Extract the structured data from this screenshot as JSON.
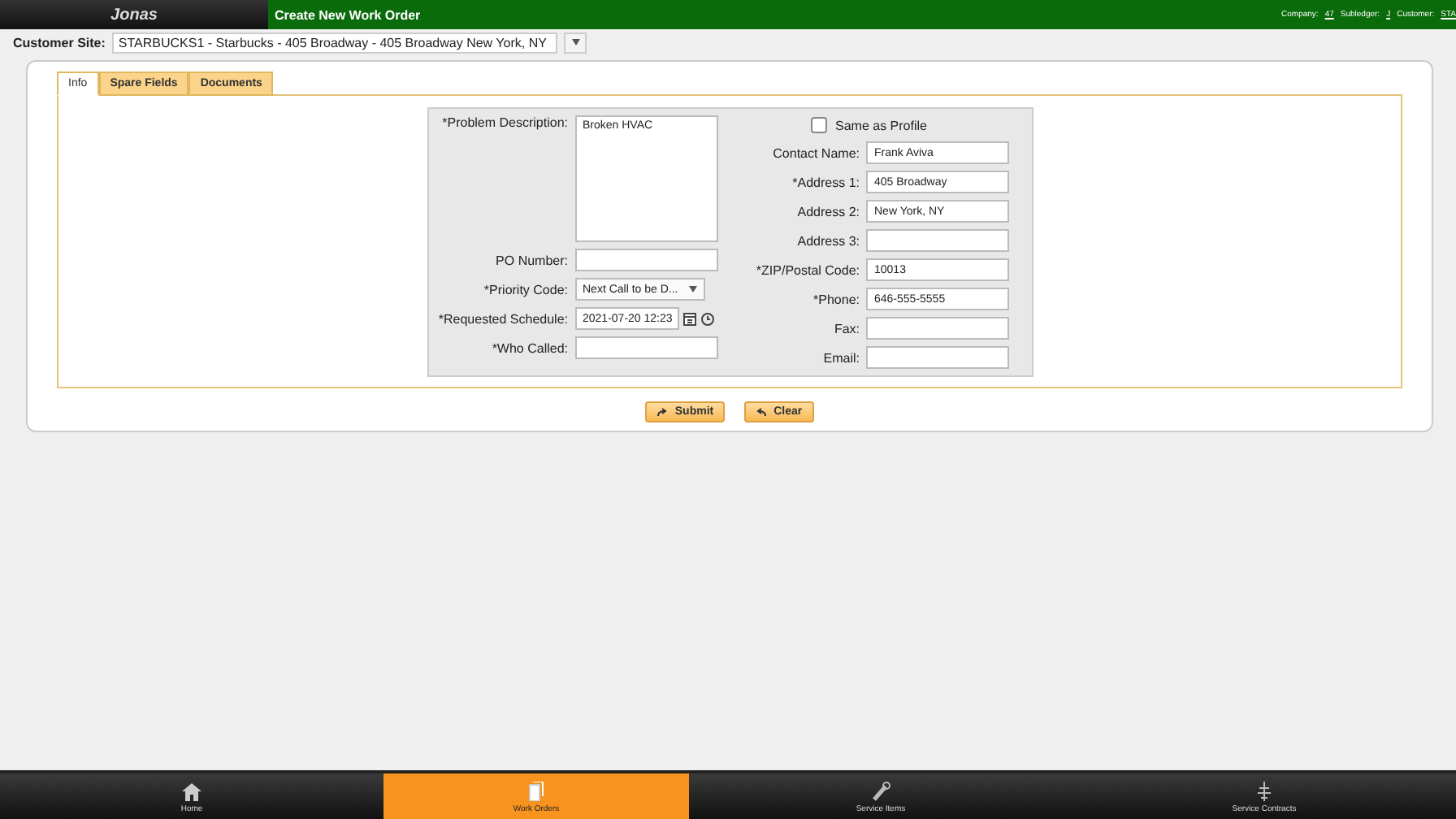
{
  "header": {
    "logo": "Jonas",
    "title": "Create New Work Order",
    "company_label": "Company:",
    "company": "47",
    "subledger_label": "Subledger:",
    "subledger": "J",
    "customer_label": "Customer:",
    "customer": "STA"
  },
  "customer_site": {
    "label": "Customer Site:",
    "value": "STARBUCKS1 - Starbucks - 405 Broadway - 405 Broadway New York, NY"
  },
  "tabs": [
    {
      "label": "Info",
      "selected": true
    },
    {
      "label": "Spare Fields",
      "selected": false
    },
    {
      "label": "Documents",
      "selected": false
    }
  ],
  "left_fields": [
    {
      "kind": "textarea",
      "label": "*Problem Description:",
      "value": "Broken HVAC"
    },
    {
      "kind": "text",
      "label": "PO Number:"
    },
    {
      "kind": "select",
      "label": "*Priority Code:",
      "value": "Next Call to be D..."
    },
    {
      "kind": "datetime",
      "label": "*Requested Schedule:",
      "value": "2021-07-20 12:23"
    },
    {
      "kind": "text",
      "label": "*Who Called:"
    }
  ],
  "same_as_profile": {
    "label": "Same as Profile",
    "checked": false
  },
  "right_fields": [
    {
      "label": "Contact Name:",
      "value": "Frank Aviva"
    },
    {
      "label": "*Address 1:",
      "value": "405 Broadway"
    },
    {
      "label": "Address 2:",
      "value": "New York, NY"
    },
    {
      "label": "Address 3:"
    },
    {
      "label": "*ZIP/Postal Code:",
      "value": "10013"
    },
    {
      "label": "*Phone:",
      "value": "646-555-5555"
    },
    {
      "label": "Fax:"
    },
    {
      "label": "Email:"
    }
  ],
  "buttons": [
    {
      "kind": "submit",
      "label": "Submit"
    },
    {
      "kind": "clear",
      "label": "Clear"
    }
  ],
  "nav": [
    {
      "kind": "home",
      "label": "Home",
      "selected": false
    },
    {
      "kind": "orders",
      "label": "Work Orders",
      "selected": true
    },
    {
      "kind": "items",
      "label": "Service Items",
      "selected": false
    },
    {
      "kind": "contracts",
      "label": "Service Contracts",
      "selected": false
    }
  ]
}
